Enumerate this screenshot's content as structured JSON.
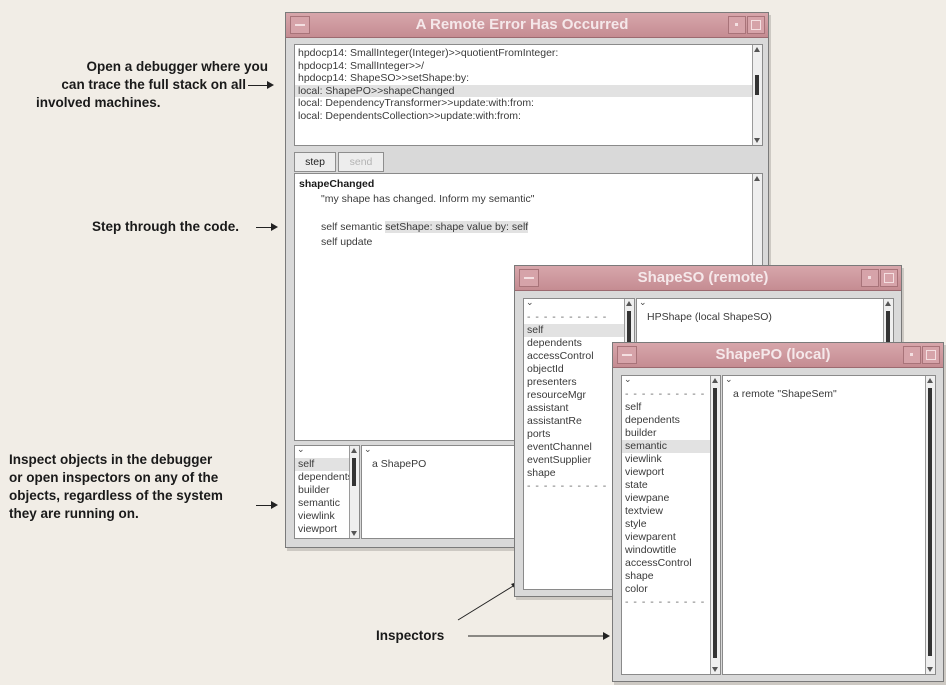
{
  "callouts": {
    "debugger": [
      "Open a debugger where you",
      "can trace the full stack on all",
      "involved machines."
    ],
    "step": "Step through the code.",
    "inspect": [
      "Inspect objects in the debugger",
      "or open inspectors on any of the",
      "objects, regardless of the system",
      "they are running on."
    ],
    "inspectors": "Inspectors"
  },
  "error_window": {
    "title": "A Remote Error Has Occurred",
    "stack": [
      "hpdocp14: SmallInteger(Integer)>>quotientFromInteger:",
      "hpdocp14: SmallInteger>>/",
      "hpdocp14: ShapeSO>>setShape:by:",
      "local: ShapePO>>shapeChanged",
      "local: DependencyTransformer>>update:with:from:",
      "local: DependentsCollection>>update:with:from:"
    ],
    "selected_stack_index": 3,
    "buttons": {
      "step": "step",
      "send": "send"
    },
    "code": {
      "method": "shapeChanged",
      "comment": "\"my shape has changed.  Inform my semantic\"",
      "line1_prefix": "self semantic ",
      "line1_highlight": "setShape: shape value by: self",
      "line2": "self update"
    },
    "inspector_vars": [
      "self",
      "dependents",
      "builder",
      "semantic",
      "viewlink",
      "viewport"
    ],
    "inspector_value": "a ShapePO"
  },
  "shapeso_window": {
    "title": "ShapeSO (remote)",
    "vars": [
      "self",
      "dependents",
      "accessControl",
      "objectId",
      "presenters",
      "resourceMgr",
      "assistant",
      "assistantRe",
      "ports",
      "eventChannel",
      "eventSupplier",
      "shape"
    ],
    "value": "HPShape (local ShapeSO)"
  },
  "shapepo_window": {
    "title": "ShapePO (local)",
    "vars": [
      "self",
      "dependents",
      "builder",
      "semantic",
      "viewlink",
      "viewport",
      "state",
      "viewpane",
      "textview",
      "style",
      "viewparent",
      "windowtitle",
      "accessControl",
      "shape",
      "color"
    ],
    "selected_var_index": 3,
    "value": "a remote \"ShapeSem\""
  },
  "dashes": "- - - - - - - - - -",
  "colors": {
    "titlebar": "#c58c92",
    "background": "#f1ede6",
    "window": "#d9d9d9"
  }
}
